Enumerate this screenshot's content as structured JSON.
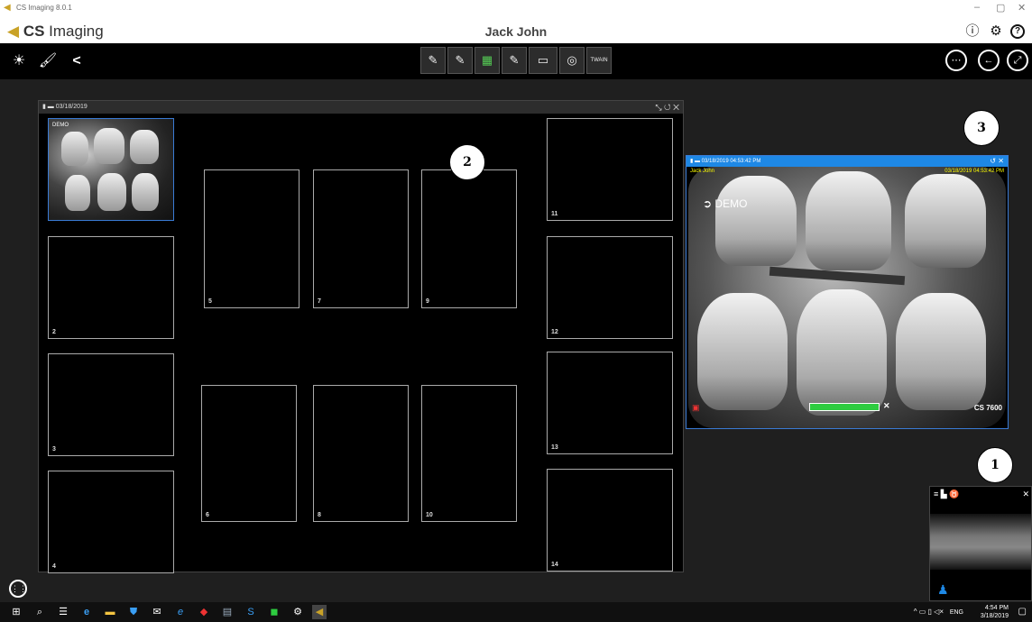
{
  "window": {
    "title": "CS Imaging 8.0.1",
    "minimize": "–",
    "restore": "▢",
    "close": "✕"
  },
  "header": {
    "brand_bold": "CS",
    "brand_rest": "Imaging",
    "patient_name": "Jack John",
    "info_glyph": "ⓘ",
    "settings_glyph": "⚙",
    "help_glyph": "?"
  },
  "toolbar": {
    "left_glyphs": [
      "☀",
      "🖌",
      "<"
    ],
    "acquisition_glyphs": [
      "✎",
      "✎",
      "▦",
      "✎",
      "▭",
      "◎",
      "TWAIN"
    ],
    "right_glyphs": [
      "⋯",
      "←",
      "⤢"
    ]
  },
  "mount": {
    "date": "03/18/2019",
    "controls": "⤡ ↺ ✕",
    "slot_numbers": [
      "2",
      "3",
      "4",
      "5",
      "6",
      "7",
      "8",
      "9",
      "10",
      "11",
      "12",
      "13",
      "14"
    ],
    "slot1_demo": "DEMO"
  },
  "viewer": {
    "timestamp": "03/18/2019 04:53:42 PM",
    "controls": "↺ ✕",
    "patient_overlay": "Jack John",
    "date_overlay": "03/18/2019 04:53:42 PM",
    "demo_label": "DEMO",
    "device": "CS 7600",
    "progress": 1.0
  },
  "callouts": [
    "1",
    "2",
    "3"
  ],
  "mini": {
    "close": "✕"
  },
  "taskbar": {
    "language": "ENG",
    "time": "4:54 PM",
    "date": "3/18/2019"
  },
  "colors": {
    "accent": "#1e88e5",
    "progress": "#2ecc40",
    "workspace": "#1f1f1f"
  }
}
